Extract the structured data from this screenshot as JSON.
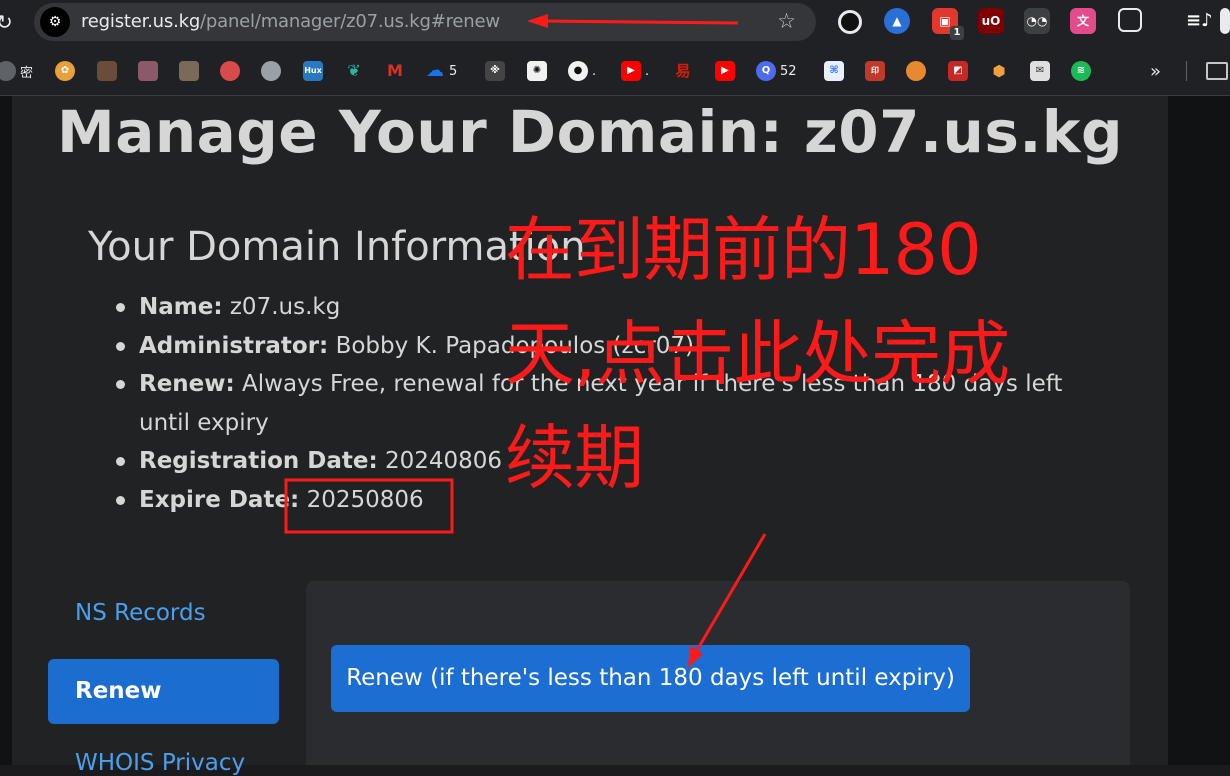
{
  "browser": {
    "url_host": "register.us.kg",
    "url_path": "/panel/manager/z07.us.kg#renew",
    "extensions": [
      {
        "icon": "circle-dark-icon",
        "color": "#111111"
      },
      {
        "icon": "triangle-blue-icon",
        "color": "#2a6fd6"
      },
      {
        "icon": "red-box-icon",
        "color": "#e0382f",
        "badge": "1"
      },
      {
        "icon": "ublock-icon",
        "color": "#800000"
      },
      {
        "icon": "glasses-icon",
        "color": "#3c4043"
      },
      {
        "icon": "translate-icon",
        "color": "#e34b8a"
      },
      {
        "icon": "puzzle-icon",
        "color": "#202124"
      }
    ],
    "bookmarks": [
      {
        "icon": "globe-icon",
        "label": "密",
        "color": "#5f6368"
      },
      {
        "icon": "pinwheel-icon",
        "label": "",
        "color": "#e8a03a"
      },
      {
        "icon": "avatar-icon",
        "label": "",
        "color": "#6b4b3a"
      },
      {
        "icon": "avatar-icon",
        "label": "",
        "color": "#8a5a6a"
      },
      {
        "icon": "avatar-icon",
        "label": "",
        "color": "#7a6a5a"
      },
      {
        "icon": "bowl-icon",
        "label": "",
        "color": "#d94a4a"
      },
      {
        "icon": "globe-icon",
        "label": "",
        "color": "#9aa0a6"
      },
      {
        "icon": "hux-icon",
        "label": "",
        "color": "#2a78c0"
      },
      {
        "icon": "leaf-icon",
        "label": "",
        "color": "#2fb3a0"
      },
      {
        "icon": "gmail-icon",
        "label": "",
        "color": "#d93025"
      },
      {
        "icon": "cloud-icon",
        "label": "5",
        "color": "#1a73e8"
      },
      {
        "icon": "pattern-icon",
        "label": "",
        "color": "#444444"
      },
      {
        "icon": "openai-icon",
        "label": "",
        "color": "#f1f1f1"
      },
      {
        "icon": "github-icon",
        "label": ".",
        "color": "#f1f1f1"
      },
      {
        "icon": "youtube-icon",
        "label": ".",
        "color": "#ff0000"
      },
      {
        "icon": "netease-icon",
        "label": "",
        "color": "#d81e06"
      },
      {
        "icon": "youtube-icon",
        "label": "",
        "color": "#ff0000"
      },
      {
        "icon": "q-icon",
        "label": "52",
        "color": "#4f6bed"
      },
      {
        "icon": "baidu-icon",
        "label": "",
        "color": "#2f7bff"
      },
      {
        "icon": "seal-icon",
        "label": "",
        "color": "#c0392b"
      },
      {
        "icon": "orange-icon",
        "label": "",
        "color": "#e8882f"
      },
      {
        "icon": "redsq-icon",
        "label": "",
        "color": "#c62828"
      },
      {
        "icon": "gem-icon",
        "label": "",
        "color": "#f0a040"
      },
      {
        "icon": "envelope-icon",
        "label": "",
        "color": "#e0e0e0"
      },
      {
        "icon": "spotify-icon",
        "label": "",
        "color": "#1db954"
      }
    ],
    "more_bookmarks": "»"
  },
  "page": {
    "title": "Manage Your Domain: z07.us.kg",
    "section_title": "Your Domain Information",
    "info": {
      "name_label": "Name:",
      "name_value": "z07.us.kg",
      "admin_label": "Administrator:",
      "admin_value": "Bobby K. Papadopoulos (zcr07)",
      "renew_label": "Renew:",
      "renew_value": "Always Free, renewal for the next year if there's less than 180 days left until expiry",
      "reg_label": "Registration Date:",
      "reg_value": "20240806",
      "expire_label": "Expire Date:",
      "expire_value": "20250806"
    },
    "nav": {
      "ns_records": "NS Records",
      "renew": "Renew",
      "whois": "WHOIS Privacy"
    },
    "renew_button": "Renew (if there's less than 180 days left until expiry)"
  },
  "annotation": {
    "line1": "在到期前的180",
    "line2": "天,点击此处完成",
    "line3": "续期",
    "color": "#ff1a1a"
  }
}
